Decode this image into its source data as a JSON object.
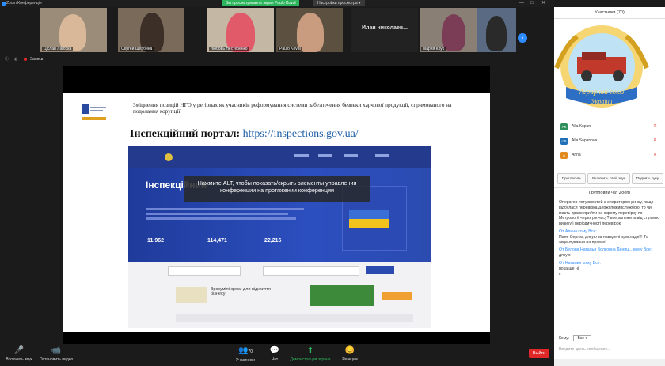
{
  "window": {
    "title": "Zoom Конференція",
    "minimize": "—",
    "maximize": "□",
    "close": "✕"
  },
  "share_banner": "Вы просматриваете экран Paulo Koval",
  "view_options": "Настройки просмотра ▾",
  "participants_strip": [
    {
      "name": "Ціслан Лагоска",
      "bg": "#9a8c78"
    },
    {
      "name": "Сергей Щербина",
      "bg": "#7a6a5a"
    },
    {
      "name": "Любовь Нестеренко",
      "bg": "#c4b7a4"
    },
    {
      "name": "Paulo Koval",
      "bg": "#5c5040"
    },
    {
      "name": "Илан николаев...",
      "bg": "#222222"
    },
    {
      "name": "Мария Крук",
      "bg": "#8a7f74"
    },
    {
      "name": "",
      "bg": "#5a6a82"
    }
  ],
  "toolrow": {
    "view_label": "Запись"
  },
  "slide": {
    "heading": "Зміцнення позицій НГО у регіонах як учасників реформування системи забезпечення безпеки харчової продукції, спрямованого на подолання корупції.",
    "portal_label": "Інспекційний портал:",
    "portal_url": "https://inspections.gov.ua/",
    "overlay": "Нажмите ALT, чтобы показать/скрыть элементы управления конференции на протяжении конференции",
    "hero_title": "Інспекційний",
    "stats": [
      "11,962",
      "114,471",
      "22,216"
    ],
    "banner_text": "Зрозумілі кроки для відкриття бізнесу"
  },
  "side_panel": {
    "title": "Участники (70)",
    "participants": [
      {
        "initials": "АК",
        "name": "Alla Kopun",
        "color": "#2f8f5a"
      },
      {
        "initials": "AS",
        "name": "Alla Sapanova",
        "color": "#1e6fb8"
      },
      {
        "initials": "A",
        "name": "Anna",
        "color": "#e08a1e"
      }
    ],
    "buttons": [
      "Пригласить",
      "Включить свой звук",
      "Поднять руку"
    ],
    "chat_title": "Групповий чат Zoom",
    "messages": [
      {
        "from": "",
        "text": "Оператор потужностей є оператором ринку, якщо відбулася перевірка Держспоживслужбою, то чи маєть право прийти на окрему перевірку по Метрології через рік часу? все залежить від ступеню ризику і періодичності перевірок"
      },
      {
        "from": "От Алина кому Все:",
        "text": "Пане Сергію, дякую за наведені приклади!!! Та акцентування на правах!"
      },
      {
        "from": "От Белова Наталья Волковна Дениц... кому Все:",
        "text": "дякую"
      },
      {
        "from": "От Наталия кому Все:",
        "text": "пока ще ні"
      },
      {
        "from": "",
        "text": "к"
      }
    ],
    "recipient_label": "Кому:",
    "recipient_value": "Все ▾",
    "input_placeholder": "Введите здесь сообщение..."
  },
  "logo": {
    "line1": "Аграрний союз",
    "line2": "України"
  },
  "bottom_bar": [
    {
      "icon": "mic-icon",
      "glyph": "🎤",
      "label": "Включить звук"
    },
    {
      "icon": "video-icon",
      "glyph": "📹",
      "label": "Остановить видео"
    },
    {
      "icon": "participants-icon",
      "glyph": "👥",
      "label": "Участники",
      "count": "70"
    },
    {
      "icon": "chat-icon",
      "glyph": "💬",
      "label": "Чат"
    },
    {
      "icon": "share-icon",
      "glyph": "⬆",
      "label": "Демонстрация экрана"
    },
    {
      "icon": "reactions-icon",
      "glyph": "😊",
      "label": "Реакции"
    }
  ],
  "leave_label": "Выйти",
  "colors": {
    "accent": "#2d8cff",
    "share_green": "#2db55d",
    "leave_red": "#e02828"
  }
}
